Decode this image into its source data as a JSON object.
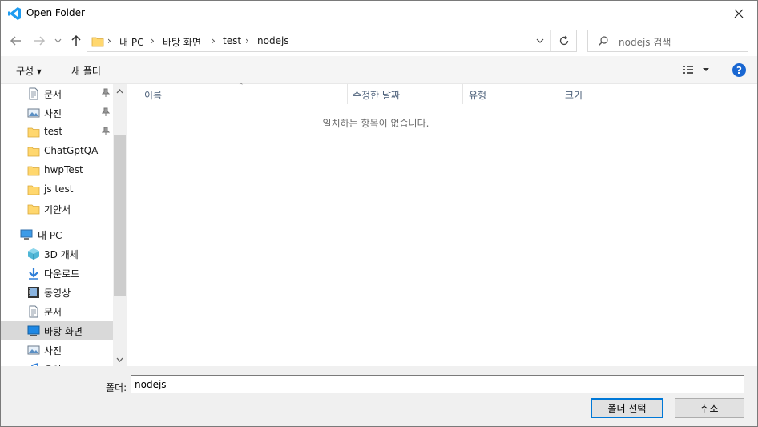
{
  "window": {
    "title": "Open Folder"
  },
  "address": {
    "crumbs": [
      "내 PC",
      "바탕 화면",
      "test",
      "nodejs"
    ],
    "sep": "›"
  },
  "search": {
    "placeholder": "nodejs 검색"
  },
  "toolbar": {
    "organize": "구성 ▾",
    "new_folder": "새 폴더",
    "help": "?"
  },
  "nav": {
    "items": [
      {
        "label": "문서",
        "icon": "document-icon",
        "pinned": true
      },
      {
        "label": "사진",
        "icon": "pictures-icon",
        "pinned": true
      },
      {
        "label": "test",
        "icon": "folder-icon",
        "pinned": true
      },
      {
        "label": "ChatGptQA",
        "icon": "folder-icon",
        "pinned": false
      },
      {
        "label": "hwpTest",
        "icon": "folder-icon",
        "pinned": false
      },
      {
        "label": "js test",
        "icon": "folder-icon",
        "pinned": false
      },
      {
        "label": "기안서",
        "icon": "folder-icon",
        "pinned": false
      },
      {
        "label": "내 PC",
        "icon": "computer-icon",
        "pinned": false
      },
      {
        "label": "3D 개체",
        "icon": "cube-icon",
        "pinned": false
      },
      {
        "label": "다운로드",
        "icon": "download-icon",
        "pinned": false
      },
      {
        "label": "동영상",
        "icon": "video-icon",
        "pinned": false
      },
      {
        "label": "문서",
        "icon": "document-icon",
        "pinned": false
      },
      {
        "label": "바탕 화면",
        "icon": "desktop-icon",
        "pinned": false,
        "selected": true
      },
      {
        "label": "사진",
        "icon": "pictures-icon",
        "pinned": false
      },
      {
        "label": "음악",
        "icon": "music-icon",
        "pinned": false
      }
    ]
  },
  "columns": [
    "이름",
    "수정한 날짜",
    "유형",
    "크기"
  ],
  "empty_message": "일치하는 항목이 없습니다.",
  "bottom": {
    "folder_label": "폴더:",
    "folder_value": "nodejs",
    "select_button": "폴더 선택",
    "cancel_button": "취소"
  },
  "colors": {
    "accent": "#0078d7",
    "folder": "#ffd76e",
    "help": "#1967d2"
  }
}
